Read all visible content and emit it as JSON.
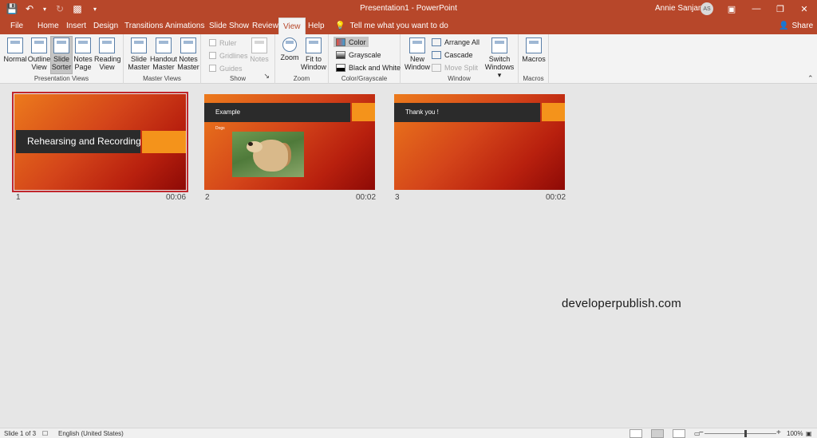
{
  "titlebar": {
    "title": "Presentation1  -  PowerPoint",
    "user_name": "Annie Sanjana",
    "user_initials": "AS"
  },
  "tabs": [
    "File",
    "Home",
    "Insert",
    "Design",
    "Transitions",
    "Animations",
    "Slide Show",
    "Review",
    "View",
    "Help"
  ],
  "active_tab": "View",
  "tell_me": "Tell me what you want to do",
  "share": "Share",
  "ribbon": {
    "presentation_views": {
      "label": "Presentation Views",
      "normal": "Normal",
      "outline_view": [
        "Outline",
        "View"
      ],
      "slide_sorter": [
        "Slide",
        "Sorter"
      ],
      "notes_page": [
        "Notes",
        "Page"
      ],
      "reading_view": [
        "Reading",
        "View"
      ]
    },
    "master_views": {
      "label": "Master Views",
      "slide_master": [
        "Slide",
        "Master"
      ],
      "handout_master": [
        "Handout",
        "Master"
      ],
      "notes_master": [
        "Notes",
        "Master"
      ]
    },
    "show": {
      "label": "Show",
      "ruler": "Ruler",
      "gridlines": "Gridlines",
      "guides": "Guides",
      "notes": "Notes"
    },
    "zoom": {
      "label": "Zoom",
      "zoom": "Zoom",
      "fit_to_window": [
        "Fit to",
        "Window"
      ]
    },
    "color_grayscale": {
      "label": "Color/Grayscale",
      "color": "Color",
      "grayscale": "Grayscale",
      "black_and_white": "Black and White"
    },
    "window": {
      "label": "Window",
      "new_window": [
        "New",
        "Window"
      ],
      "arrange_all": "Arrange All",
      "cascade": "Cascade",
      "move_split": "Move Split",
      "switch_windows": [
        "Switch",
        "Windows"
      ]
    },
    "macros": {
      "label": "Macros",
      "macros": "Macros"
    }
  },
  "slides": [
    {
      "number": "1",
      "time": "00:06",
      "title": "Rehearsing and Recording",
      "subtitle": ""
    },
    {
      "number": "2",
      "time": "00:02",
      "title": "Example",
      "subtitle": "Dogs"
    },
    {
      "number": "3",
      "time": "00:02",
      "title": "Thank you !",
      "subtitle": ""
    }
  ],
  "watermark": "developerpublish.com",
  "statusbar": {
    "slide_info": "Slide 1 of 3",
    "language": "English (United States)",
    "zoom_minus": "−",
    "zoom_plus": "+",
    "zoom_level": "100%"
  },
  "colors": {
    "accent": "#b7472a",
    "slide_dark": "#2b2b2b",
    "slide_orange": "#f4931b"
  }
}
